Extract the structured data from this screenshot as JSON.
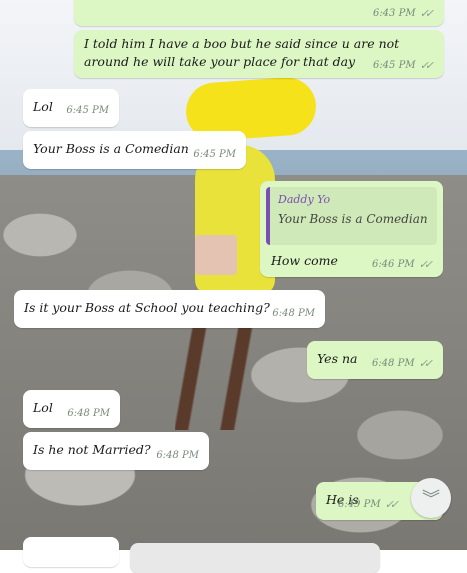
{
  "messages": [
    {
      "id": "m1",
      "dir": "out",
      "text": "",
      "time": "6:43 PM",
      "ticks": "✓✓"
    },
    {
      "id": "m2",
      "dir": "out",
      "text": "I told him I have a boo but he said since u are not around he will take your place for that day",
      "time": "6:45 PM",
      "ticks": "✓✓"
    },
    {
      "id": "m3",
      "dir": "in",
      "text": "Lol",
      "time": "6:45 PM"
    },
    {
      "id": "m4",
      "dir": "in",
      "text": "Your Boss is a Comedian",
      "time": "6:45 PM"
    },
    {
      "id": "m5",
      "dir": "out",
      "quote": {
        "name": "Daddy Yo",
        "text": "Your Boss is a Comedian"
      },
      "text": "How come",
      "time": "6:46 PM",
      "ticks": "✓✓"
    },
    {
      "id": "m6",
      "dir": "in",
      "text": "Is it your Boss at School you teaching?",
      "time": "6:48 PM"
    },
    {
      "id": "m7",
      "dir": "out",
      "text": "Yes na",
      "time": "6:48 PM",
      "ticks": "✓✓"
    },
    {
      "id": "m8",
      "dir": "in",
      "text": "Lol",
      "time": "6:48 PM"
    },
    {
      "id": "m9",
      "dir": "in",
      "text": "Is he not Married?",
      "time": "6:48 PM"
    },
    {
      "id": "m10",
      "dir": "out",
      "text": "He is",
      "time": "6:49 PM",
      "ticks": "✓✓"
    }
  ],
  "scroll_button": {
    "icon": "chevron-double-down-icon",
    "glyph": "︾"
  },
  "colors": {
    "outgoing": "#dcf6c4",
    "incoming": "#ffffff",
    "quote_accent": "#7a4fb3"
  }
}
